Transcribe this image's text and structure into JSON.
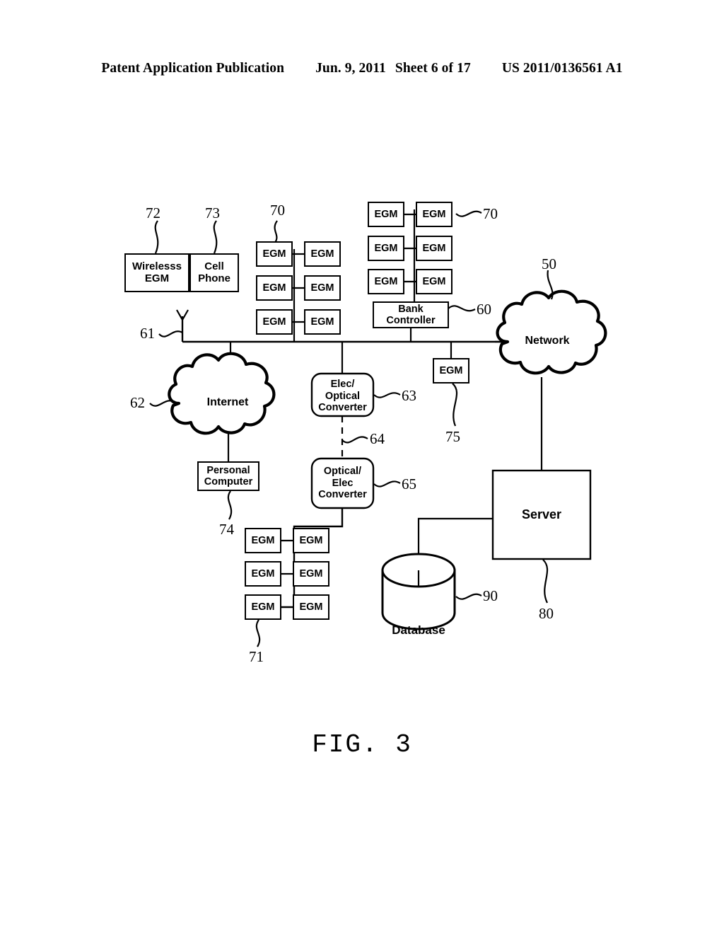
{
  "header": {
    "publication": "Patent Application Publication",
    "date": "Jun. 9, 2011",
    "sheet": "Sheet 6 of 17",
    "number": "US 2011/0136561 A1"
  },
  "figure": {
    "caption": "FIG.  3"
  },
  "nodes": {
    "wireless_egm": "Wirelesss\nEGM",
    "wireless_egm_line1": "Wirelesss",
    "wireless_egm_line2": "EGM",
    "cell_phone_line1": "Cell",
    "cell_phone_line2": "Phone",
    "bank_controller_line1": "Bank",
    "bank_controller_line2": "Controller",
    "elec_optical_line1": "Elec/",
    "elec_optical_line2": "Optical",
    "elec_optical_line3": "Converter",
    "optical_elec_line1": "Optical/",
    "optical_elec_line2": "Elec",
    "optical_elec_line3": "Converter",
    "personal_computer_line1": "Personal",
    "personal_computer_line2": "Computer",
    "egm": "EGM",
    "server": "Server",
    "network": "Network",
    "internet": "Internet",
    "database": "Database"
  },
  "refs": {
    "r50": "50",
    "r60": "60",
    "r61": "61",
    "r62": "62",
    "r63": "63",
    "r64": "64",
    "r65": "65",
    "r70_left": "70",
    "r70_right": "70",
    "r71": "71",
    "r72": "72",
    "r73": "73",
    "r74": "74",
    "r75": "75",
    "r80": "80",
    "r90": "90"
  },
  "colors": {
    "ink": "#000000",
    "paper": "#ffffff"
  },
  "diagram": {
    "type": "block-diagram",
    "title": "FIG. 3",
    "egm_bank_left_count": 6,
    "egm_bank_right_count": 6,
    "egm_bank_bottom_count": 6,
    "standalone_egm_count": 1
  }
}
